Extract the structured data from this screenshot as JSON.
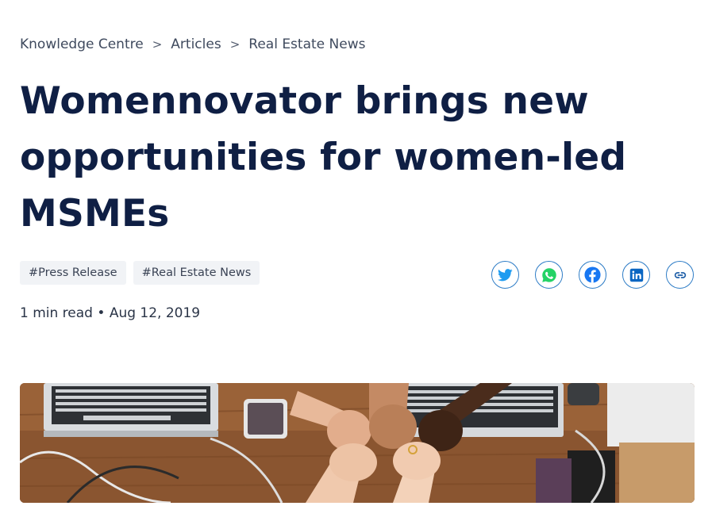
{
  "breadcrumb": {
    "items": [
      "Knowledge Centre",
      "Articles",
      "Real Estate News"
    ],
    "separator": ">"
  },
  "article": {
    "title_lines": [
      "Womennovator brings new",
      "opportunities for women-led",
      "MSMEs"
    ],
    "tags": [
      "#Press Release",
      "#Real Estate News"
    ],
    "read_time": "1 min read",
    "bullet": "•",
    "date": "Aug 12, 2019"
  },
  "share": {
    "icons": [
      "twitter-icon",
      "whatsapp-icon",
      "facebook-icon",
      "linkedin-icon",
      "link-icon"
    ]
  },
  "colors": {
    "title": "#0f1f44",
    "share_border": "#2d7cc6",
    "twitter": "#1d9bf0",
    "whatsapp": "#25d366",
    "facebook": "#1877f2",
    "linkedin": "#0a66c2",
    "tag_bg": "#f1f3f6"
  }
}
